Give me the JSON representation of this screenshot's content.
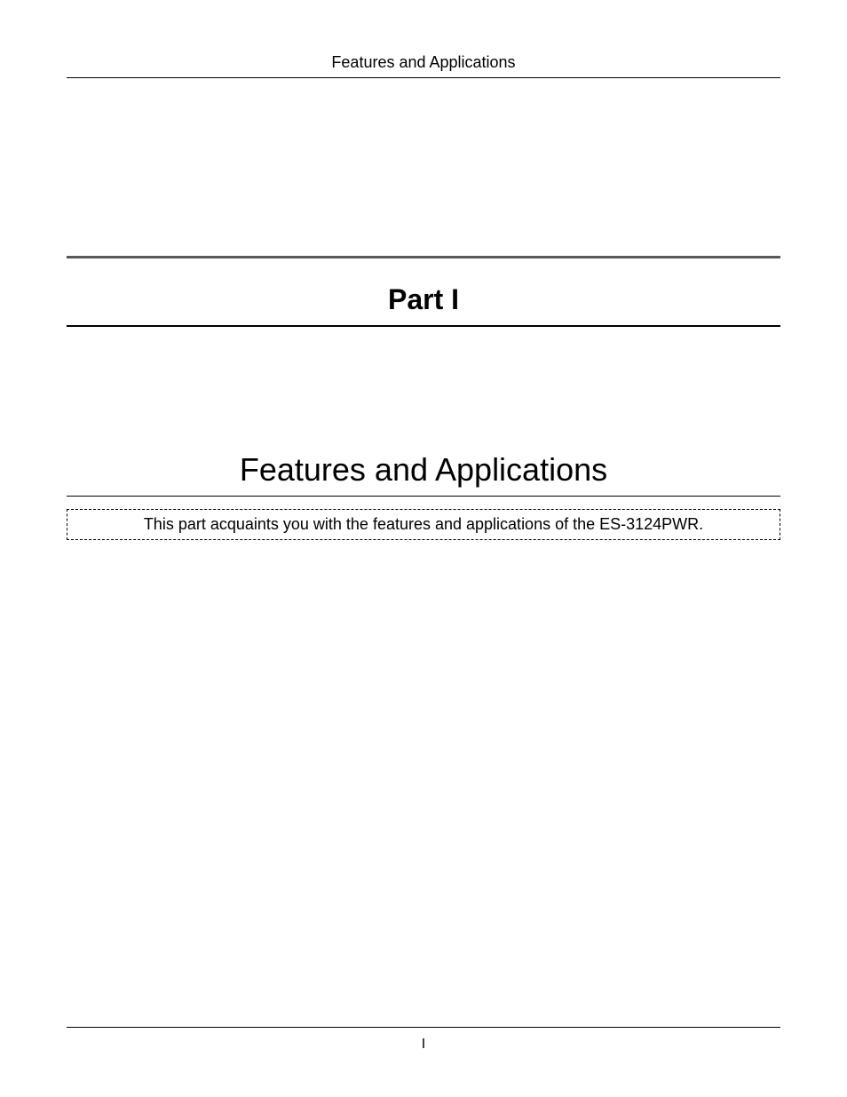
{
  "header": {
    "running_title": "Features and Applications"
  },
  "part": {
    "label": "Part I"
  },
  "section": {
    "title": "Features and Applications",
    "description": "This part acquaints you with the features and applications of the ES-3124PWR."
  },
  "footer": {
    "page_number": "I"
  }
}
